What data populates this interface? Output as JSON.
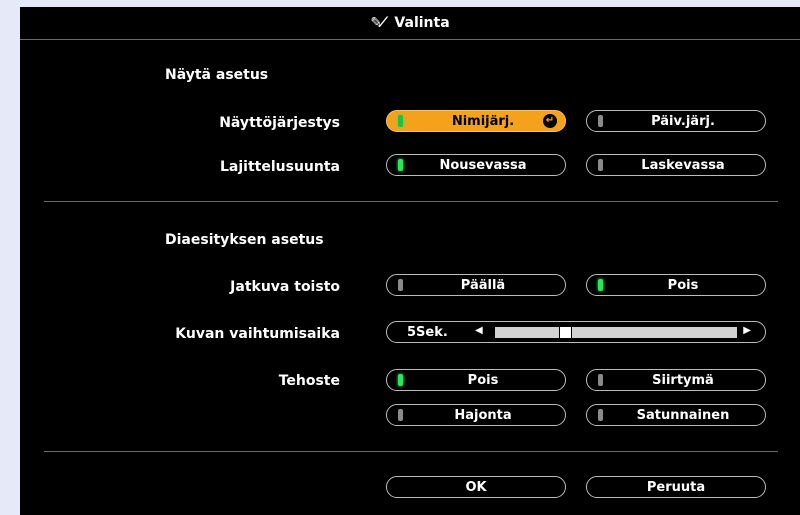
{
  "title": "Valinta",
  "title_icon": "tools-icon",
  "sections": {
    "display": "Näytä asetus",
    "slideshow": "Diaesityksen asetus"
  },
  "rows": {
    "order": {
      "label": "Näyttöjärjestys",
      "opt1": "Nimijärj.",
      "opt2": "Päiv.järj.",
      "selected": "opt1"
    },
    "sort": {
      "label": "Lajittelusuunta",
      "opt1": "Nousevassa",
      "opt2": "Laskevassa",
      "selected": "opt1"
    },
    "repeat": {
      "label": "Jatkuva toisto",
      "opt1": "Päällä",
      "opt2": "Pois",
      "selected": "opt2"
    },
    "interval": {
      "label": "Kuvan vaihtumisaika",
      "value": "5Sek.",
      "level": 0.28
    },
    "effect": {
      "label": "Tehoste",
      "opt1": "Pois",
      "opt2": "Siirtymä",
      "opt3": "Hajonta",
      "opt4": "Satunnainen",
      "selected": "opt1"
    }
  },
  "buttons": {
    "ok": "OK",
    "cancel": "Peruuta"
  },
  "colors": {
    "background": "#000000",
    "highlight": "#f4a21c",
    "led_on": "#2ee55e",
    "led_off": "#8a8a8a",
    "track": "#d2d2d2"
  }
}
